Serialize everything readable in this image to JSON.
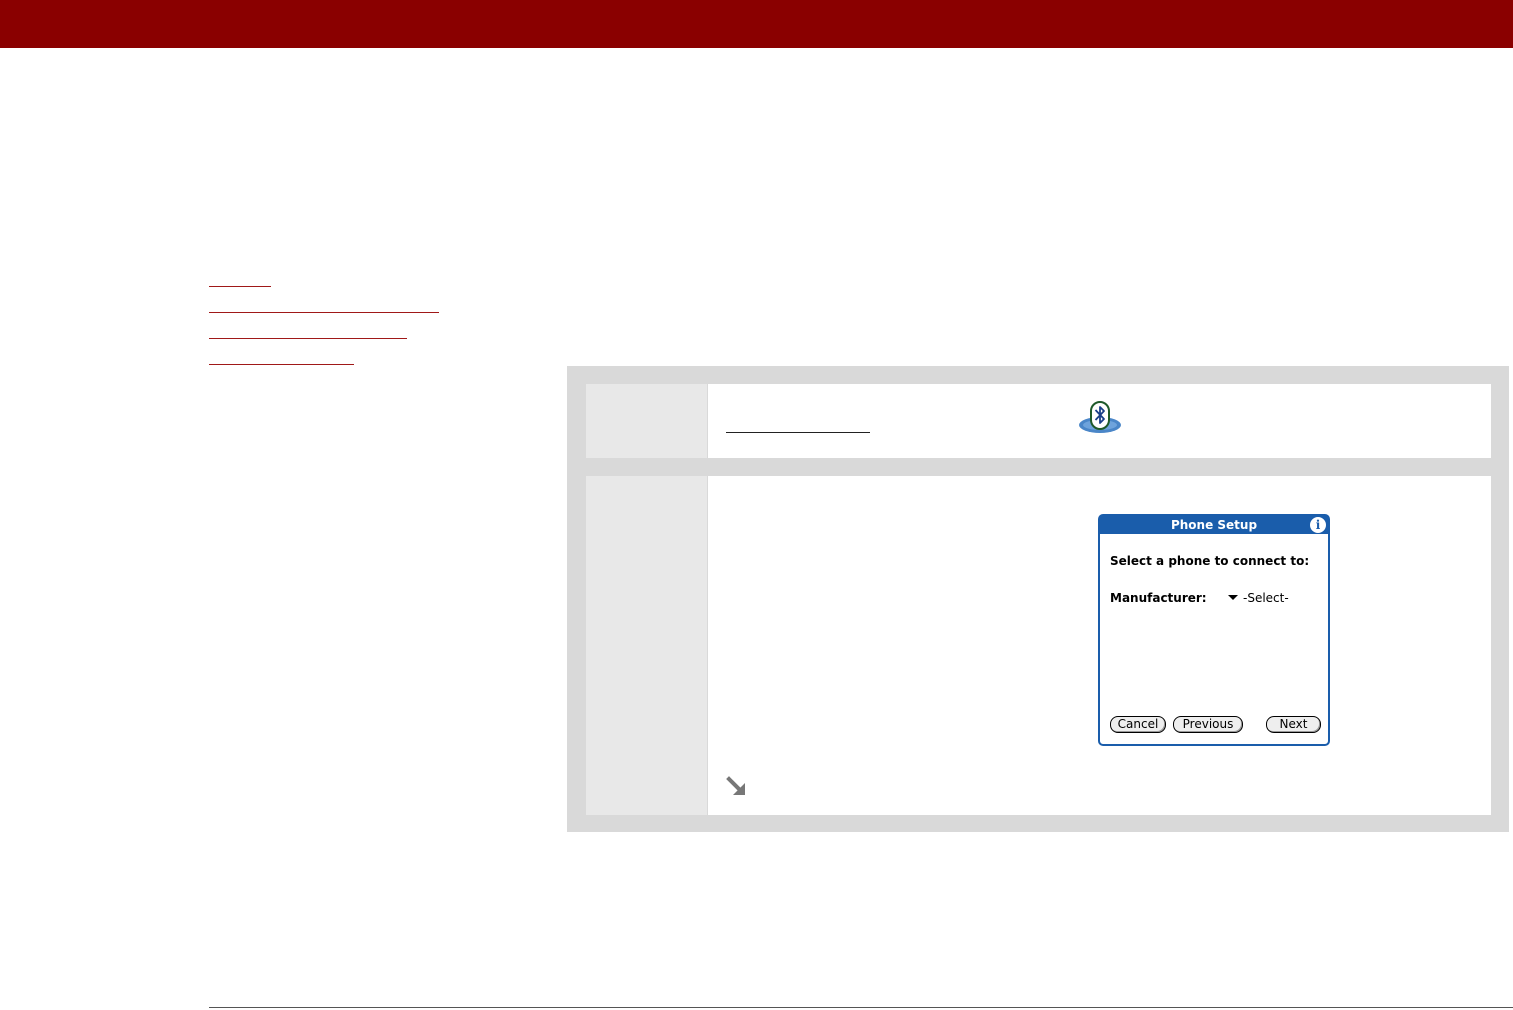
{
  "colors": {
    "header_bar": "#8a0000",
    "link": "#a01818",
    "panel": "#d9d9d9",
    "palm_accent": "#1a5dab"
  },
  "side_links": [
    "",
    "",
    "",
    ""
  ],
  "steps": [
    {
      "number": "",
      "text": "",
      "icon": "bluetooth-icon"
    },
    {
      "number": "",
      "text": "",
      "continue_icon": "continue-arrow-icon"
    }
  ],
  "phone_setup": {
    "title": "Phone Setup",
    "info_icon": "i",
    "prompt": "Select a phone to connect to:",
    "manufacturer_label": "Manufacturer:",
    "manufacturer_value": "-Select-",
    "buttons": {
      "cancel": "Cancel",
      "previous": "Previous",
      "next": "Next"
    }
  }
}
